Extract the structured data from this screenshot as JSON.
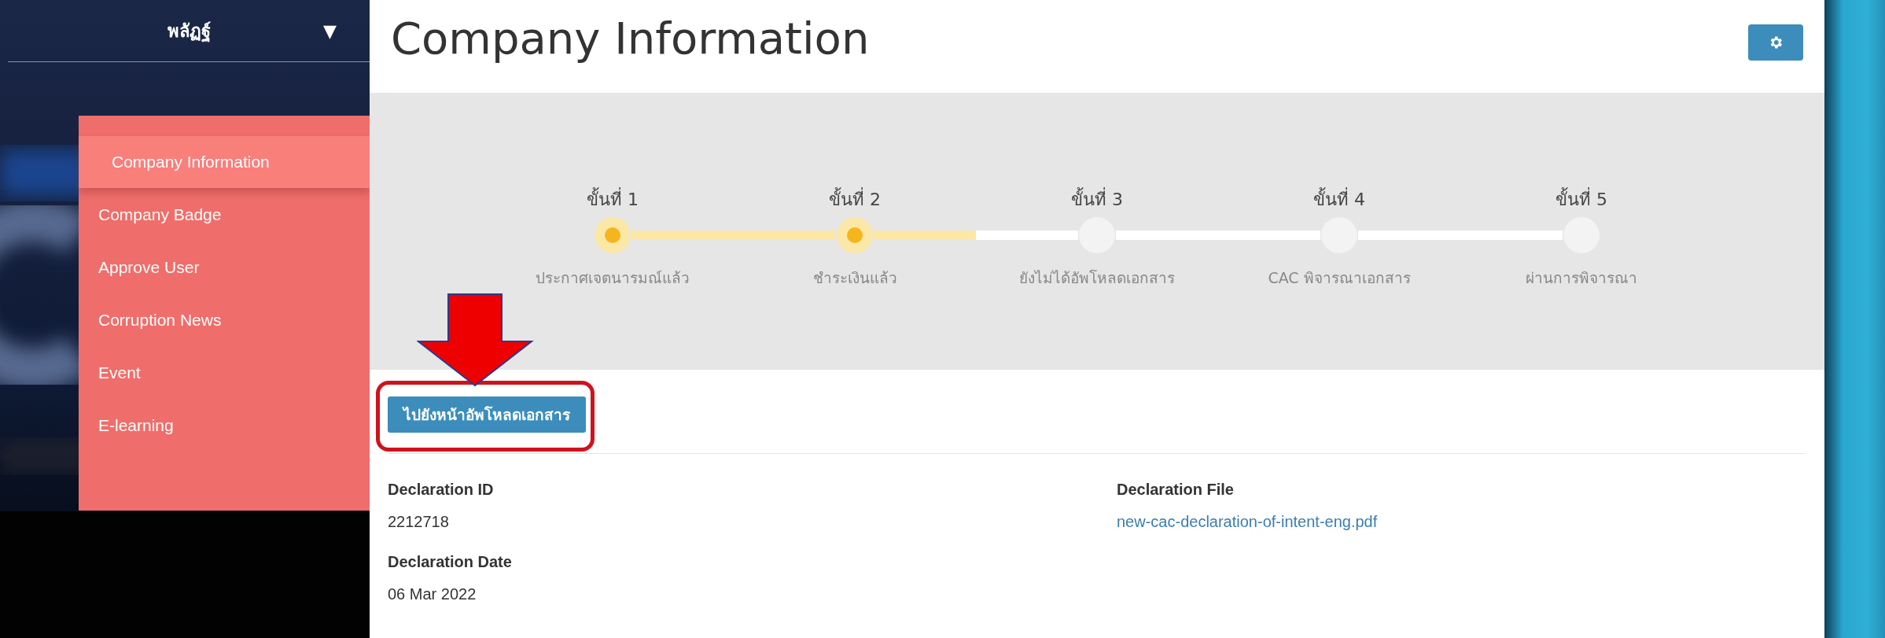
{
  "sidebar": {
    "user": "พลัฏฐ์",
    "user_menu": "▼",
    "menu": [
      {
        "label": "Company Information",
        "selected": true
      },
      {
        "label": "Company Badge",
        "selected": false
      },
      {
        "label": "Approve User",
        "selected": false
      },
      {
        "label": "Corruption News",
        "selected": false
      },
      {
        "label": "Event",
        "selected": false
      },
      {
        "label": "E-learning",
        "selected": false
      }
    ]
  },
  "page": {
    "title": "Company Information"
  },
  "steps": [
    {
      "label": "ขั้นที่ 1",
      "caption": "ประกาศเจตนารมณ์แล้ว",
      "done": true
    },
    {
      "label": "ขั้นที่ 2",
      "caption": "ชำระเงินแล้ว",
      "done": true
    },
    {
      "label": "ขั้นที่ 3",
      "caption": "ยังไม่ได้อัพโหลดเอกสาร",
      "done": false
    },
    {
      "label": "ขั้นที่ 4",
      "caption": "CAC พิจารณาเอกสาร",
      "done": false
    },
    {
      "label": "ขั้นที่ 5",
      "caption": "ผ่านการพิจารณา",
      "done": false
    }
  ],
  "upload_button": {
    "label": "ไปยังหน้าอัพโหลดเอกสาร"
  },
  "field_columns": [
    [
      {
        "label": "Declaration ID",
        "value": "2212718",
        "kind": "text"
      },
      {
        "label": "Declaration Date",
        "value": "06 Mar 2022",
        "kind": "text"
      }
    ],
    [
      {
        "label": "Declaration File",
        "value": "new-cac-declaration-of-intent-eng.pdf",
        "kind": "link"
      }
    ]
  ]
}
